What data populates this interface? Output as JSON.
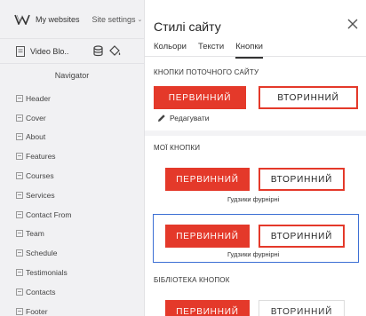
{
  "topbar": {
    "site_name": "My websites",
    "settings_label": "Site settings"
  },
  "subbar": {
    "page_name": "Video Blo.."
  },
  "navigator": {
    "title": "Navigator",
    "items": [
      "Header",
      "Cover",
      "About",
      "Features",
      "Courses",
      "Services",
      "Contact From",
      "Team",
      "Schedule",
      "Testimonials",
      "Contacts",
      "Footer"
    ]
  },
  "panel": {
    "title": "Стилі сайту",
    "tabs": [
      "Кольори",
      "Тексти",
      "Кнопки"
    ],
    "active_tab": 2,
    "site_buttons_label": "КНОПКИ ПОТОЧНОГО САЙТУ",
    "primary_label": "ПЕРВИННИЙ",
    "secondary_label": "ВТОРИННИЙ",
    "edit_label": "Редагувати",
    "my_buttons_label": "МОЇ КНОПКИ",
    "caption1": "Гудзики фурнірні",
    "caption2": "Гудзики фурнірні",
    "library_label": "БІБЛІОТЕКА КНОПОК"
  },
  "colors": {
    "accent": "#e4392a",
    "selection": "#3c6fd4"
  },
  "icons": [
    "logo-icon",
    "chevron-down-icon",
    "page-icon",
    "database-icon",
    "paint-bucket-icon",
    "close-icon",
    "pencil-icon",
    "section-icon"
  ]
}
